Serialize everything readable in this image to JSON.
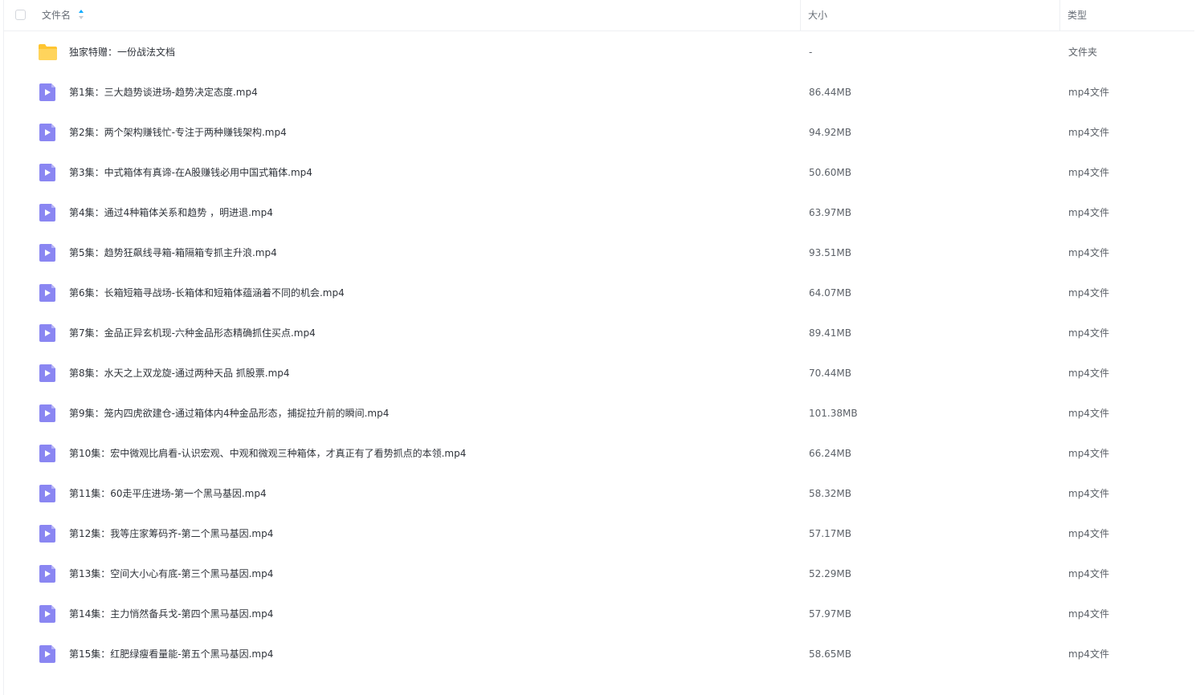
{
  "colors": {
    "folder": "#ffc531",
    "video_icon": "#8a86f2",
    "sort_active": "#09aaff"
  },
  "header": {
    "name_label": "文件名",
    "size_label": "大小",
    "type_label": "类型",
    "sort_icon": "sort-ascending-icon"
  },
  "rows": [
    {
      "icon": "folder-icon",
      "name": "独家特赠：一份战法文档",
      "size": "-",
      "type": "文件夹"
    },
    {
      "icon": "video-file-icon",
      "name": "第1集：三大趋势谈进场-趋势决定态度.mp4",
      "size": "86.44MB",
      "type": "mp4文件"
    },
    {
      "icon": "video-file-icon",
      "name": "第2集：两个架构赚钱忙-专注于两种赚钱架构.mp4",
      "size": "94.92MB",
      "type": "mp4文件"
    },
    {
      "icon": "video-file-icon",
      "name": "第3集：中式箱体有真谛-在A股赚钱必用中国式箱体.mp4",
      "size": "50.60MB",
      "type": "mp4文件"
    },
    {
      "icon": "video-file-icon",
      "name": "第4集：通过4种箱体关系和趋势 ，明进退.mp4",
      "size": "63.97MB",
      "type": "mp4文件"
    },
    {
      "icon": "video-file-icon",
      "name": "第5集：趋势狂飙线寻箱-箱隔箱专抓主升浪.mp4",
      "size": "93.51MB",
      "type": "mp4文件"
    },
    {
      "icon": "video-file-icon",
      "name": "第6集：长箱短箱寻战场-长箱体和短箱体蕴涵着不同的机会.mp4",
      "size": "64.07MB",
      "type": "mp4文件"
    },
    {
      "icon": "video-file-icon",
      "name": "第7集：金品正异玄机现-六种金品形态精确抓住买点.mp4",
      "size": "89.41MB",
      "type": "mp4文件"
    },
    {
      "icon": "video-file-icon",
      "name": "第8集：水天之上双龙旋-通过两种天品 抓股票.mp4",
      "size": "70.44MB",
      "type": "mp4文件"
    },
    {
      "icon": "video-file-icon",
      "name": "第9集：笼内四虎欲建仓-通过箱体内4种金品形态，捕捉拉升前的瞬间.mp4",
      "size": "101.38MB",
      "type": "mp4文件"
    },
    {
      "icon": "video-file-icon",
      "name": "第10集：宏中微观比肩看-认识宏观、中观和微观三种箱体，才真正有了看势抓点的本领.mp4",
      "size": "66.24MB",
      "type": "mp4文件"
    },
    {
      "icon": "video-file-icon",
      "name": "第11集：60走平庄进场-第一个黑马基因.mp4",
      "size": "58.32MB",
      "type": "mp4文件"
    },
    {
      "icon": "video-file-icon",
      "name": "第12集：我等庄家筹码齐-第二个黑马基因.mp4",
      "size": "57.17MB",
      "type": "mp4文件"
    },
    {
      "icon": "video-file-icon",
      "name": "第13集：空间大小心有底-第三个黑马基因.mp4",
      "size": "52.29MB",
      "type": "mp4文件"
    },
    {
      "icon": "video-file-icon",
      "name": "第14集：主力悄然备兵戈-第四个黑马基因.mp4",
      "size": "57.97MB",
      "type": "mp4文件"
    },
    {
      "icon": "video-file-icon",
      "name": "第15集：红肥绿瘦看量能-第五个黑马基因.mp4",
      "size": "58.65MB",
      "type": "mp4文件"
    }
  ]
}
